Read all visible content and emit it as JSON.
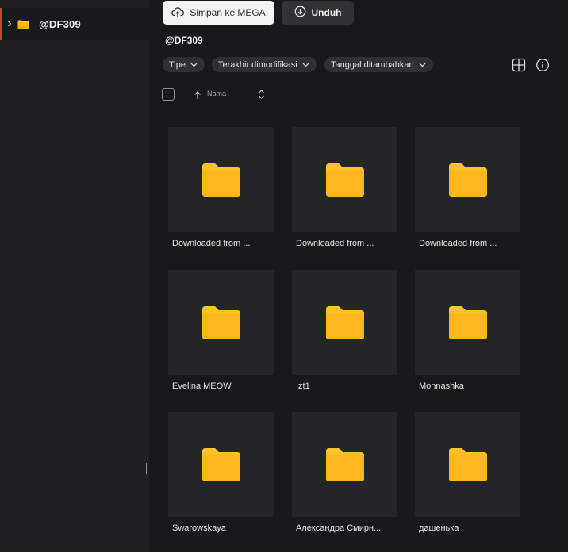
{
  "sidebar": {
    "tree_item_label": "@DF309",
    "accent_color": "#e0383e"
  },
  "toolbar": {
    "save_label": "Simpan ke MEGA",
    "download_label": "Unduh"
  },
  "main": {
    "title": "@DF309",
    "filters": [
      {
        "label": "Tipe"
      },
      {
        "label": "Terakhir dimodifikasi"
      },
      {
        "label": "Tanggal ditambahkan"
      }
    ],
    "sort": {
      "label": "Nama"
    }
  },
  "folder_color": "#ffb21c",
  "folders": [
    {
      "label": "Downloaded from ..."
    },
    {
      "label": "Downloaded from ..."
    },
    {
      "label": "Downloaded from ..."
    },
    {
      "label": "Evelina MEOW"
    },
    {
      "label": "Izt1"
    },
    {
      "label": "Monnashka"
    },
    {
      "label": "Swarowskaya"
    },
    {
      "label": "Александра Смирн..."
    },
    {
      "label": "дашенька"
    }
  ]
}
